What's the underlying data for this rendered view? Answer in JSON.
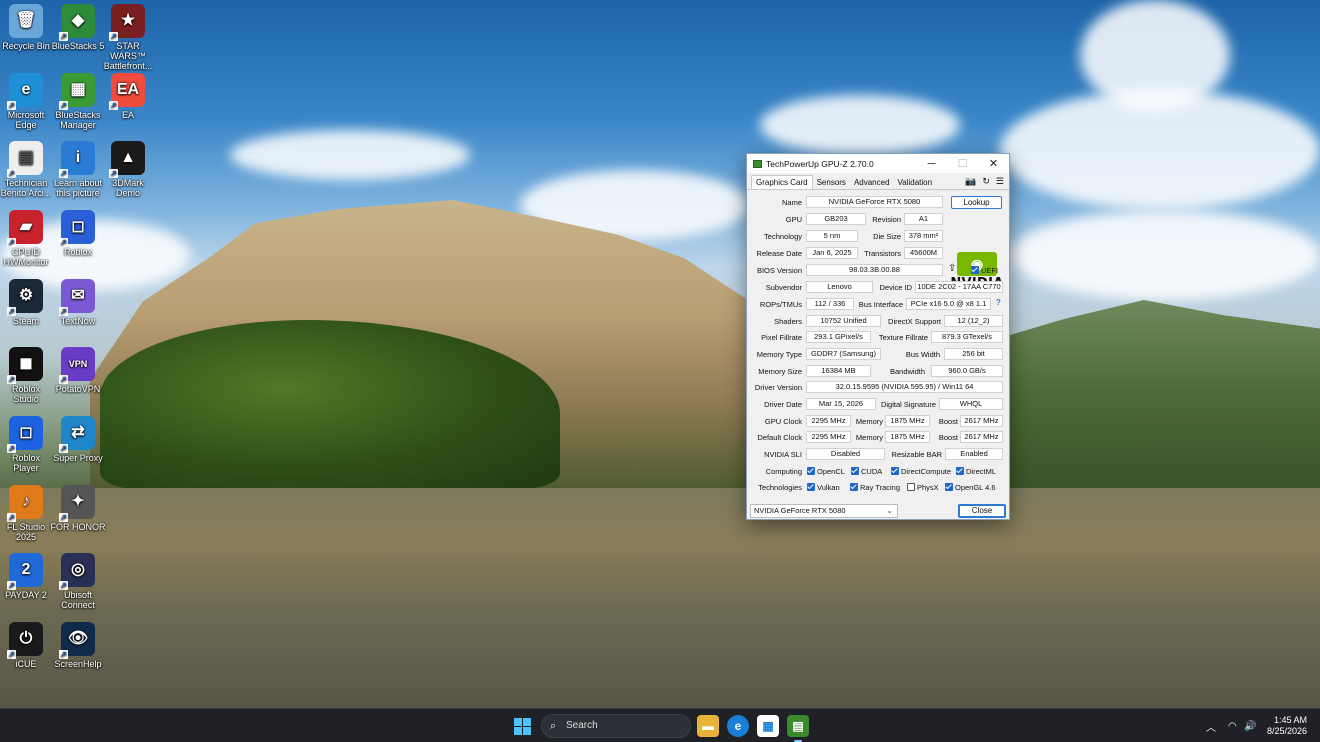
{
  "desktop": {
    "icons": [
      {
        "label": "Recycle Bin",
        "glyph": "🗑"
      },
      {
        "label": "BlueStacks 5",
        "glyph": "◆"
      },
      {
        "label": "STAR WARS™ Battlefront...",
        "glyph": "★"
      },
      {
        "label": "Microsoft Edge",
        "glyph": "e"
      },
      {
        "label": "BlueStacks Manager",
        "glyph": "▦"
      },
      {
        "label": "EA",
        "glyph": "EA"
      },
      {
        "label": "Technician Benito Arci...",
        "glyph": "▤"
      },
      {
        "label": "Learn about this picture",
        "glyph": "i"
      },
      {
        "label": "3DMark Demo",
        "glyph": "▲"
      },
      {
        "label": "CPUID HWMonitor",
        "glyph": "▰"
      },
      {
        "label": "Roblox",
        "glyph": "◻"
      },
      {
        "label": "Steam",
        "glyph": "⚙"
      },
      {
        "label": "TextNow",
        "glyph": "✉"
      },
      {
        "label": "Roblox Studio",
        "glyph": "◼"
      },
      {
        "label": "PotatoVPN",
        "glyph": "VPN"
      },
      {
        "label": "Roblox Player",
        "glyph": "◻"
      },
      {
        "label": "Super Proxy",
        "glyph": "⇄"
      },
      {
        "label": "FL Studio 2025",
        "glyph": "♪"
      },
      {
        "label": "FOR HONOR",
        "glyph": "✦"
      },
      {
        "label": "PAYDAY 2",
        "glyph": "2"
      },
      {
        "label": "Ubisoft Connect",
        "glyph": "◎"
      },
      {
        "label": "iCUE",
        "glyph": "⏻"
      },
      {
        "label": "ScreenHelp",
        "glyph": "👁"
      }
    ]
  },
  "gpuz": {
    "title": "TechPowerUp GPU-Z 2.70.0",
    "tabs": [
      "Graphics Card",
      "Sensors",
      "Advanced",
      "Validation"
    ],
    "lookup_label": "Lookup",
    "uefi_label": "UEFI",
    "logo_text": "NVIDIA",
    "labels": {
      "name": "Name",
      "gpu": "GPU",
      "revision": "Revision",
      "technology": "Technology",
      "die_size": "Die Size",
      "release_date": "Release Date",
      "transistors": "Transistors",
      "bios_version": "BIOS Version",
      "subvendor": "Subvendor",
      "device_id": "Device ID",
      "rops_tmus": "ROPs/TMUs",
      "bus_interface": "Bus Interface",
      "shaders": "Shaders",
      "directx_support": "DirectX Support",
      "pixel_fillrate": "Pixel Fillrate",
      "texture_fillrate": "Texture Fillrate",
      "memory_type": "Memory Type",
      "bus_width": "Bus Width",
      "memory_size": "Memory Size",
      "bandwidth": "Bandwidth",
      "driver_version": "Driver Version",
      "driver_date": "Driver Date",
      "digital_signature": "Digital Signature",
      "gpu_clock": "GPU Clock",
      "memory": "Memory",
      "boost": "Boost",
      "default_clock": "Default Clock",
      "nvidia_sli": "NVIDIA SLI",
      "resizable_bar": "Resizable BAR",
      "computing": "Computing",
      "technologies": "Technologies"
    },
    "values": {
      "name": "NVIDIA GeForce RTX 5080",
      "gpu": "GB203",
      "revision": "A1",
      "technology": "5 nm",
      "die_size": "378 mm²",
      "release_date": "Jan 6, 2025",
      "transistors": "45600M",
      "bios_version": "98.03.3B.00.88",
      "subvendor": "Lenovo",
      "device_id": "10DE 2C02 - 17AA C770",
      "rops_tmus": "112 / 336",
      "bus_interface": "PCIe x16 5.0 @ x8 1.1",
      "shaders": "10752 Unified",
      "directx_support": "12 (12_2)",
      "pixel_fillrate": "293.1 GPixel/s",
      "texture_fillrate": "879.3 GTexel/s",
      "memory_type": "GDDR7 (Samsung)",
      "bus_width": "256 bit",
      "memory_size": "16384 MB",
      "bandwidth": "960.0 GB/s",
      "driver_version": "32.0.15.9595 (NVIDIA 595.95) / Win11 64",
      "driver_date": "Mar 15, 2026",
      "digital_signature": "WHQL",
      "gpu_clock": "2295 MHz",
      "gpu_memory": "1875 MHz",
      "gpu_boost": "2617 MHz",
      "default_clock": "2295 MHz",
      "default_memory": "1875 MHz",
      "default_boost": "2617 MHz",
      "nvidia_sli": "Disabled",
      "resizable_bar": "Enabled"
    },
    "computing": [
      "OpenCL",
      "CUDA",
      "DirectCompute",
      "DirectML"
    ],
    "technologies": [
      "Vulkan",
      "Ray Tracing",
      "PhysX",
      "OpenGL 4.6"
    ],
    "physx_checked": false,
    "gpu_select": "NVIDIA GeForce RTX 5080",
    "close_label": "Close",
    "bus_help": "?"
  },
  "taskbar": {
    "search_placeholder": "Search",
    "time": "1:45 AM",
    "date": "8/25/2026"
  }
}
